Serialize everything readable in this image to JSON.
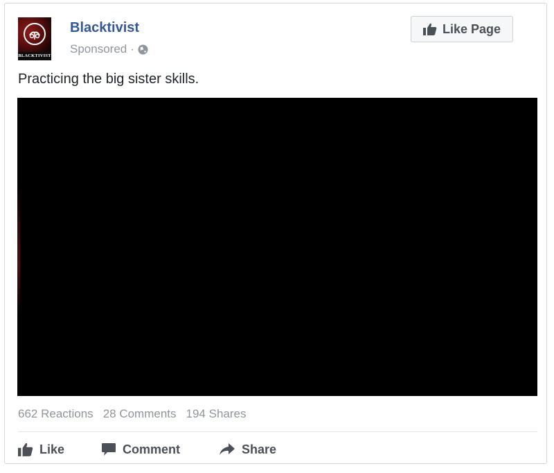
{
  "post": {
    "page_name": "Blacktivist",
    "sponsored": "Sponsored",
    "separator": "·",
    "avatar_text": "BLACKTIVIST",
    "like_page_label": "Like Page",
    "text": "Practicing the big sister skills."
  },
  "stats": {
    "reactions": "662 Reactions",
    "comments": "28 Comments",
    "shares": "194 Shares"
  },
  "actions": {
    "like": "Like",
    "comment": "Comment",
    "share": "Share"
  },
  "colors": {
    "link": "#365899",
    "meta": "#90949c",
    "action_text": "#4b4f56",
    "video_bg": "#000000"
  },
  "icons": {
    "avatar": "fist-logo-icon",
    "privacy": "globe-icon",
    "like_page": "thumbs-up-icon",
    "like": "thumbs-up-icon",
    "comment": "speech-bubble-icon",
    "share": "share-arrow-icon"
  }
}
